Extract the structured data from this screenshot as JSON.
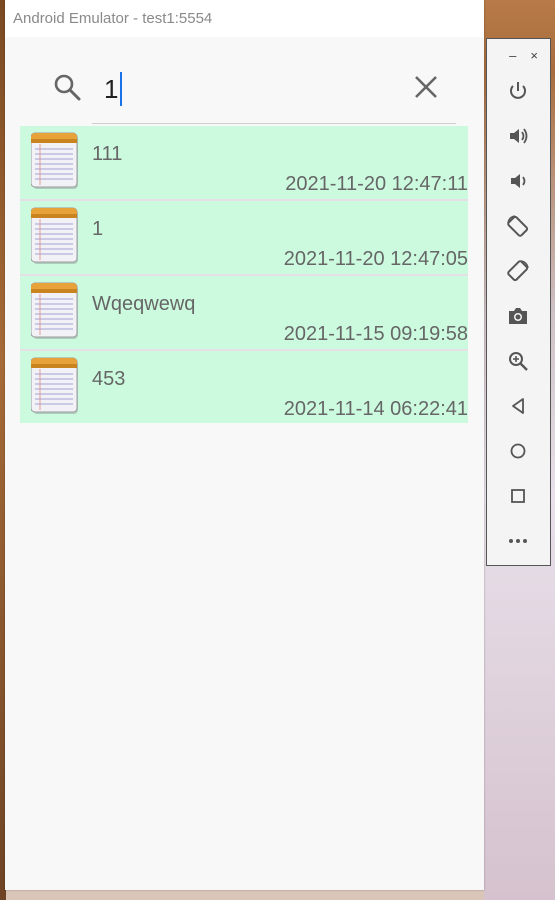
{
  "window": {
    "title": "Android Emulator - test1:5554"
  },
  "search": {
    "value": "1"
  },
  "notes": [
    {
      "title": "111",
      "date": "2021-11-20 12:47:11"
    },
    {
      "title": "1",
      "date": "2021-11-20 12:47:05"
    },
    {
      "title": "Wqeqwewq",
      "date": "2021-11-15 09:19:58"
    },
    {
      "title": "453",
      "date": "2021-11-14 06:22:41"
    }
  ],
  "toolbar": {
    "minimize": "–",
    "close": "×",
    "buttons": [
      "power-icon",
      "volume-up-icon",
      "volume-down-icon",
      "rotate-left-icon",
      "rotate-right-icon",
      "camera-icon",
      "zoom-icon",
      "back-icon",
      "home-icon",
      "overview-icon",
      "more-icon"
    ]
  },
  "colors": {
    "row_bg": "#ccfadf",
    "cursor": "#1a73e8"
  }
}
